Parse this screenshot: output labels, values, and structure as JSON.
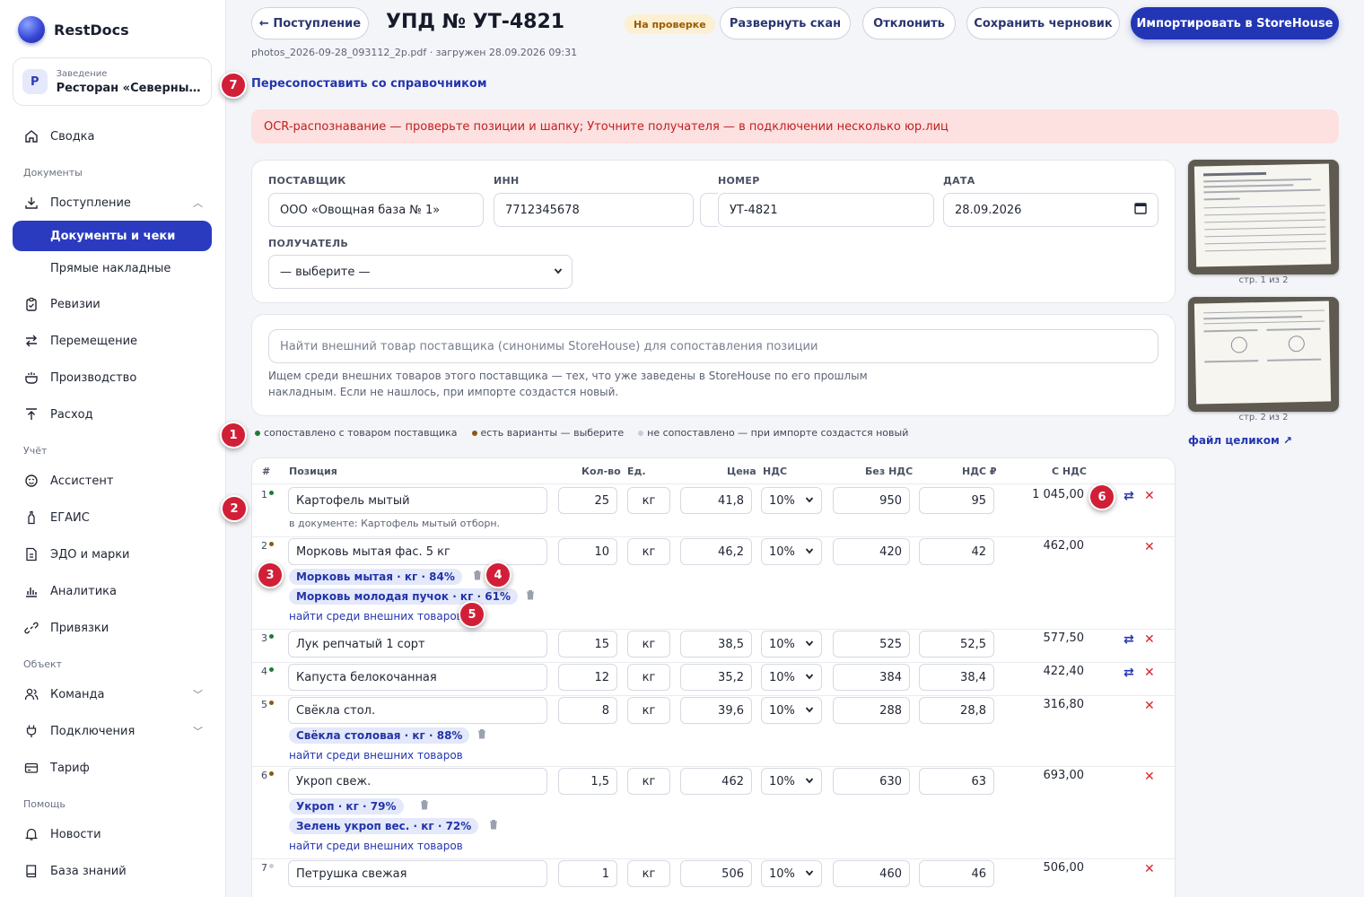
{
  "brand": {
    "name": "RestDocs"
  },
  "venue": {
    "caption": "Заведение",
    "badge": "Р",
    "name": "Ресторан «Северный двор»"
  },
  "nav": {
    "summary": "Сводка",
    "section_docs": "Документы",
    "receipts": "Поступление",
    "docs_checks": "Документы и чеки",
    "direct_invoices": "Прямые накладные",
    "revisions": "Ревизии",
    "transfer": "Перемещение",
    "production": "Производство",
    "expense": "Расход",
    "section_accounting": "Учёт",
    "assistant": "Ассистент",
    "egais": "ЕГАИС",
    "edo": "ЭДО и марки",
    "analytics": "Аналитика",
    "bindings": "Привязки",
    "section_object": "Объект",
    "team": "Команда",
    "connections": "Подключения",
    "tariff": "Тариф",
    "section_help": "Помощь",
    "news": "Новости",
    "knowledge": "База знаний"
  },
  "header": {
    "back_label": "← Поступление",
    "title": "УПД № УТ-4821",
    "status": "На проверке",
    "expand_scan": "Развернуть скан",
    "reject": "Отклонить",
    "save_draft": "Сохранить черновик",
    "import": "Импортировать в StoreHouse",
    "file_meta": "photos_2026-09-28_093112_2p.pdf · загружен 28.09.2026 09:31",
    "remap": "Пересопоставить со справочником"
  },
  "alert": "OCR-распознавание — проверьте позиции и шапку; Уточните получателя — в подключении несколько юр.лиц",
  "form": {
    "supplier_label": "ПОСТАВЩИК",
    "supplier_value": "ООО «Овощная база № 1»",
    "inn_label": "ИНН",
    "inn_value": "7712345678",
    "number_label": "НОМЕР",
    "number_value": "УТ-4821",
    "date_label": "ДАТА",
    "date_value": "28.09.2026",
    "recipient_label": "ПОЛУЧАТЕЛЬ",
    "recipient_value": "— выберите —"
  },
  "search": {
    "placeholder": "Найти внешний товар поставщика (синонимы StoreHouse) для сопоставления позиции",
    "hint": "Ищем среди внешних товаров этого поставщика — тех, что уже заведены в StoreHouse по его прошлым накладным. Если не нашлось, при импорте создастся новый."
  },
  "legend": {
    "matched": "сопоставлено с товаром поставщика",
    "variants": "есть варианты — выберите",
    "unmatched": "не сопоставлено — при импорте создастся новый"
  },
  "table": {
    "headers": {
      "num": "#",
      "position": "Позиция",
      "qty": "Кол-во",
      "unit": "Ед.",
      "price": "Цена",
      "vat": "НДС",
      "no_vat": "Без НДС",
      "vat_rub": "НДС ₽",
      "with_vat": "С НДС"
    },
    "find_link": "найти среди внешних товаров",
    "rows": [
      {
        "n": "1",
        "name": "Картофель мытый",
        "note": "в документе: Картофель мытый отборн.",
        "qty": "25",
        "unit": "кг",
        "price": "41,8",
        "vat": "10%",
        "no_vat": "950",
        "vat_rub": "95",
        "total": "1 045,00"
      },
      {
        "n": "2",
        "name": "Морковь мытая фас. 5 кг",
        "qty": "10",
        "unit": "кг",
        "price": "46,2",
        "vat": "10%",
        "no_vat": "420",
        "vat_rub": "42",
        "total": "462,00",
        "chips": [
          "Морковь мытая · кг · 84%",
          "Морковь молодая пучок · кг · 61%"
        ]
      },
      {
        "n": "3",
        "name": "Лук репчатый 1 сорт",
        "qty": "15",
        "unit": "кг",
        "price": "38,5",
        "vat": "10%",
        "no_vat": "525",
        "vat_rub": "52,5",
        "total": "577,50"
      },
      {
        "n": "4",
        "name": "Капуста белокочанная",
        "qty": "12",
        "unit": "кг",
        "price": "35,2",
        "vat": "10%",
        "no_vat": "384",
        "vat_rub": "38,4",
        "total": "422,40"
      },
      {
        "n": "5",
        "name": "Свёкла стол.",
        "qty": "8",
        "unit": "кг",
        "price": "39,6",
        "vat": "10%",
        "no_vat": "288",
        "vat_rub": "28,8",
        "total": "316,80",
        "chips": [
          "Свёкла столовая · кг · 88%"
        ]
      },
      {
        "n": "6",
        "name": "Укроп свеж.",
        "qty": "1,5",
        "unit": "кг",
        "price": "462",
        "vat": "10%",
        "no_vat": "630",
        "vat_rub": "63",
        "total": "693,00",
        "chips": [
          "Укроп · кг · 79%",
          "Зелень укроп вес. · кг · 72%"
        ]
      },
      {
        "n": "7",
        "name": "Петрушка свежая",
        "qty": "1",
        "unit": "кг",
        "price": "506",
        "vat": "10%",
        "no_vat": "460",
        "vat_rub": "46",
        "total": "506,00"
      }
    ]
  },
  "scans": {
    "page1": "стр. 1 из 2",
    "page2": "стр. 2 из 2",
    "file_link": "файл целиком ↗"
  },
  "markers": [
    "1",
    "2",
    "3",
    "4",
    "5",
    "6",
    "7"
  ],
  "colors": {
    "accent": "#2236b5",
    "matched": "#1e7a3c",
    "variants": "#8a5a14",
    "unmatched": "#c9ccd4",
    "danger": "#d21f38"
  }
}
